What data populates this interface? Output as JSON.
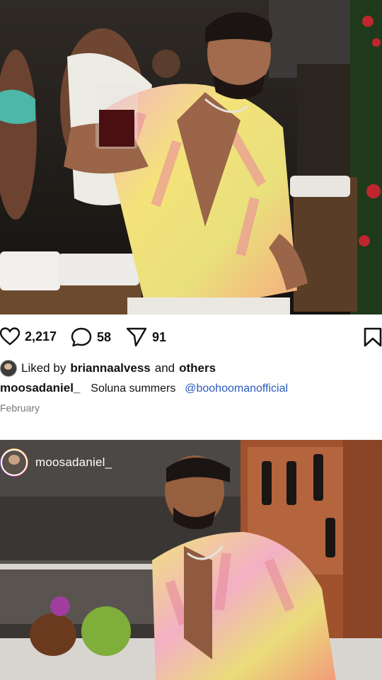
{
  "post1": {
    "stats": {
      "likes": "2,217",
      "comments": "58",
      "shares": "91"
    },
    "liked_by": {
      "prefix": "Liked by",
      "user": "briannaalvess",
      "connector": "and",
      "others": "others"
    },
    "caption": {
      "username": "moosadaniel_",
      "text": "Soluna summers",
      "tag": "@boohoomanofficial"
    },
    "date": "February"
  },
  "post2": {
    "username": "moosadaniel_"
  },
  "colors": {
    "link": "#2a5abf",
    "date": "#777777",
    "text": "#111111"
  },
  "icons": [
    "heart-icon",
    "comment-icon",
    "send-icon",
    "bookmark-icon"
  ]
}
